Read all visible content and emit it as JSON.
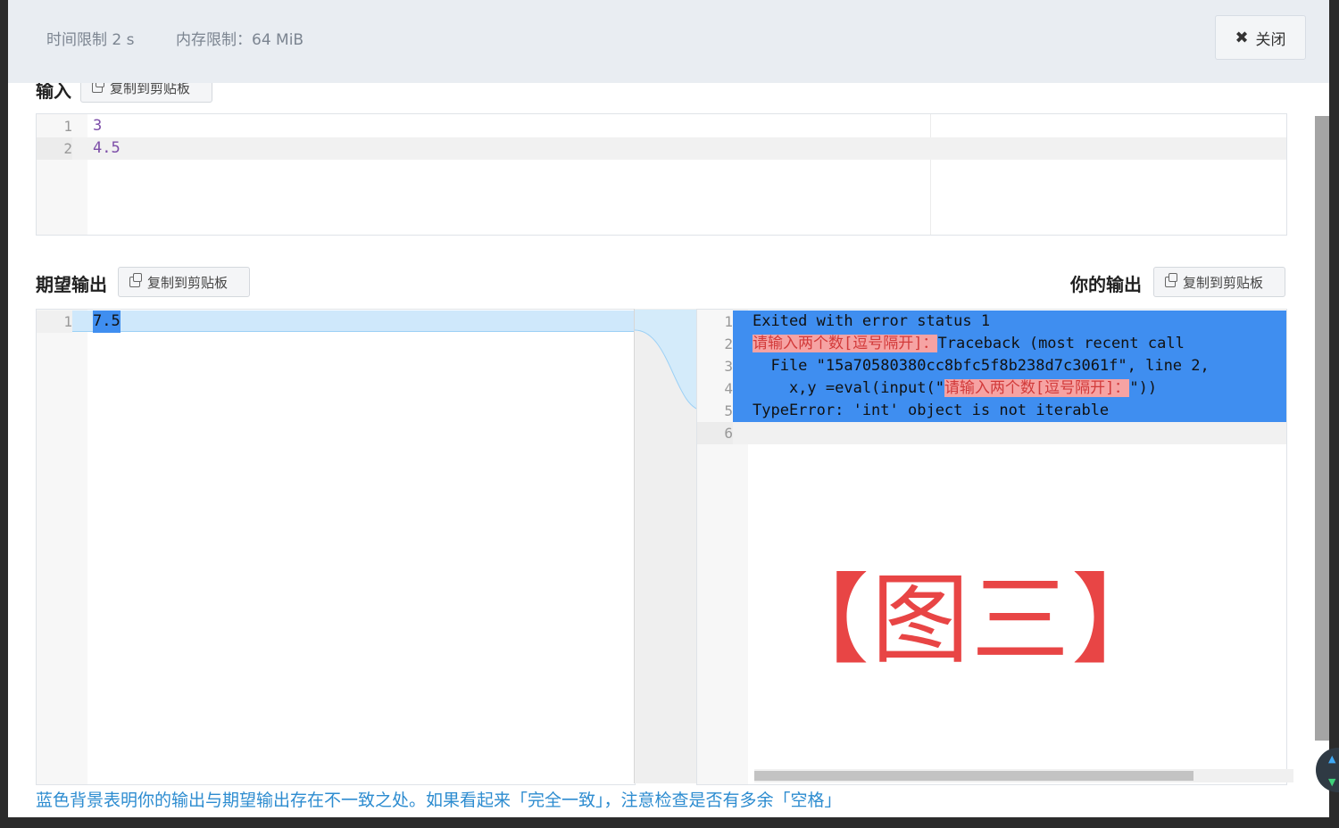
{
  "header": {
    "time_limit": "时间限制 2 s",
    "memory_limit": "内存限制：64 MiB",
    "close_label": "关闭"
  },
  "input": {
    "title": "输入",
    "copy_label": "复制到剪贴板",
    "lines": [
      "3",
      "4.5"
    ]
  },
  "expected": {
    "title": "期望输出",
    "copy_label": "复制到剪贴板",
    "lines": [
      "7.5"
    ]
  },
  "yours": {
    "title": "你的输出",
    "copy_label": "复制到剪贴板",
    "lines": [
      "Exited with error status 1",
      "请输入两个数[逗号隔开]：Traceback (most recent call",
      "  File \"15a70580380cc8bfc5f8b238d7c3061f\", line 2,",
      "    x,y =eval(input(\"请输入两个数[逗号隔开]：\"))",
      "TypeError: 'int' object is not iterable",
      ""
    ]
  },
  "stamp": "【图三】",
  "note": "蓝色背景表明你的输出与期望输出存在不一致之处。如果看起来「完全一致」，注意检查是否有多余「空格」",
  "colors": {
    "diff_line": "#3f8ef0",
    "diff_highlight": "#cfe8fb",
    "cjk_marker": "#f6a3a3",
    "note_text": "#2d8cd0",
    "stamp": "#e84545"
  }
}
